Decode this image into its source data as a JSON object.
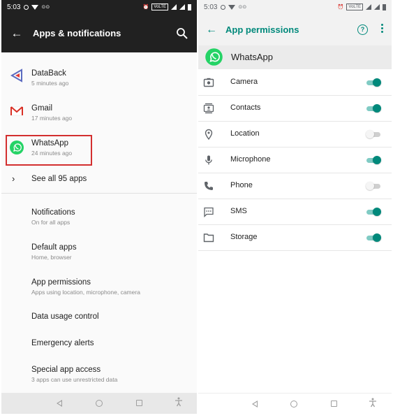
{
  "left": {
    "status": {
      "time": "5:03",
      "volte": "VoLTE"
    },
    "header": {
      "title": "Apps & notifications"
    },
    "recent_apps": [
      {
        "name": "DataBack",
        "time": "5 minutes ago"
      },
      {
        "name": "Gmail",
        "time": "17 minutes ago"
      },
      {
        "name": "WhatsApp",
        "time": "24 minutes ago"
      }
    ],
    "see_all": "See all 95 apps",
    "settings": [
      {
        "title": "Notifications",
        "subtitle": "On for all apps"
      },
      {
        "title": "Default apps",
        "subtitle": "Home, browser"
      },
      {
        "title": "App permissions",
        "subtitle": "Apps using location, microphone, camera"
      },
      {
        "title": "Data usage control",
        "subtitle": ""
      },
      {
        "title": "Emergency alerts",
        "subtitle": ""
      },
      {
        "title": "Special app access",
        "subtitle": "3 apps can use unrestricted data"
      }
    ]
  },
  "right": {
    "status": {
      "time": "5:03",
      "volte": "VoLTE"
    },
    "header": {
      "title": "App permissions",
      "help": "?"
    },
    "app": {
      "name": "WhatsApp"
    },
    "permissions": [
      {
        "label": "Camera",
        "icon": "camera-icon",
        "enabled": true
      },
      {
        "label": "Contacts",
        "icon": "contacts-icon",
        "enabled": true
      },
      {
        "label": "Location",
        "icon": "location-icon",
        "enabled": false
      },
      {
        "label": "Microphone",
        "icon": "microphone-icon",
        "enabled": true
      },
      {
        "label": "Phone",
        "icon": "phone-icon",
        "enabled": false
      },
      {
        "label": "SMS",
        "icon": "sms-icon",
        "enabled": true
      },
      {
        "label": "Storage",
        "icon": "folder-icon",
        "enabled": true
      }
    ]
  },
  "colors": {
    "accent": "#00897b",
    "toggle_track_on": "#80cbc4",
    "highlight_box": "#d32f2f",
    "dark_bar": "#212121",
    "whatsapp_green": "#25d366"
  }
}
